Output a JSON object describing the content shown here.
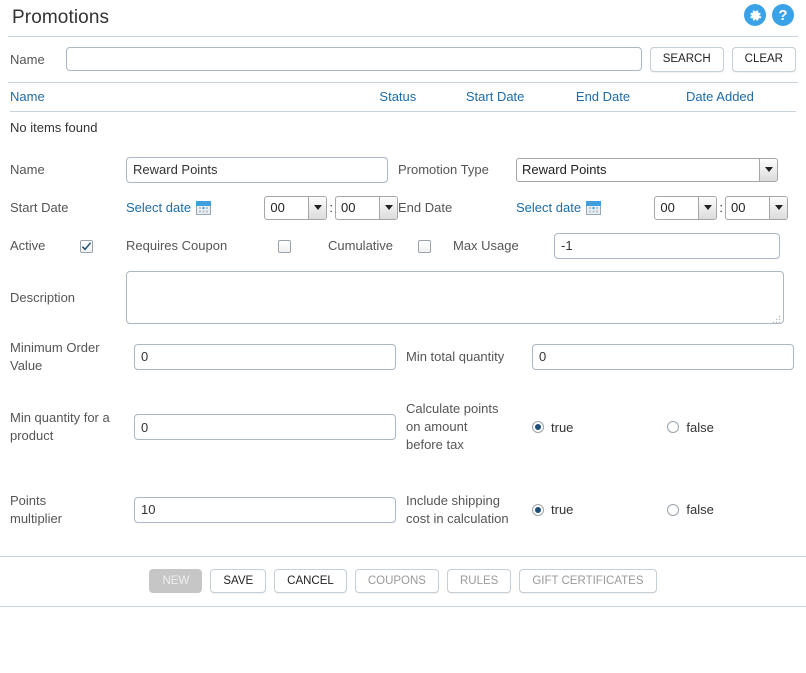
{
  "header": {
    "title": "Promotions",
    "settings_icon": "gear-icon",
    "help_icon": "help-icon",
    "accent_color": "#3aa3e8"
  },
  "search": {
    "name_label": "Name",
    "name_value": "",
    "name_placeholder": "",
    "search_button": "SEARCH",
    "clear_button": "CLEAR"
  },
  "results": {
    "columns": [
      "Name",
      "Status",
      "Start Date",
      "End Date",
      "Date Added"
    ],
    "empty_message": "No items found",
    "rows": [],
    "link_color": "#1d6ca8"
  },
  "form": {
    "name_label": "Name",
    "name_value": "Reward Points",
    "promotion_type_label": "Promotion Type",
    "promotion_type_value": "Reward Points",
    "promotion_type_options": [
      "Reward Points"
    ],
    "start_date_label": "Start Date",
    "start_date_link": "Select date",
    "start_date_icon": "calendar-icon",
    "start_hour": "00",
    "start_minute": "00",
    "end_date_label": "End Date",
    "end_date_link": "Select date",
    "end_date_icon": "calendar-icon",
    "end_hour": "00",
    "end_minute": "00",
    "time_separator": ":",
    "time_options": [
      "00"
    ],
    "active_label": "Active",
    "active_checked": true,
    "requires_coupon_label": "Requires Coupon",
    "requires_coupon_checked": false,
    "cumulative_label": "Cumulative",
    "cumulative_checked": false,
    "max_usage_label": "Max Usage",
    "max_usage_value": "-1",
    "description_label": "Description",
    "description_value": "",
    "minimum_order_value_label": "Minimum Order Value",
    "minimum_order_value": "0",
    "min_total_quantity_label": "Min total quantity",
    "min_total_quantity_value": "0",
    "min_quantity_product_label": "Min quantity for a product",
    "min_quantity_product_value": "0",
    "calculate_points_label": "Calculate points on amount before tax",
    "calculate_points_true": "true",
    "calculate_points_false": "false",
    "calculate_points_selected": "true",
    "points_multiplier_label": "Points multiplier",
    "points_multiplier_value": "10",
    "include_shipping_label": "Include shipping cost in calculation",
    "include_shipping_true": "true",
    "include_shipping_false": "false",
    "include_shipping_selected": "true"
  },
  "footer": {
    "new_button": "NEW",
    "save_button": "SAVE",
    "cancel_button": "CANCEL",
    "coupons_button": "COUPONS",
    "rules_button": "RULES",
    "gift_certificates_button": "GIFT CERTIFICATES"
  }
}
